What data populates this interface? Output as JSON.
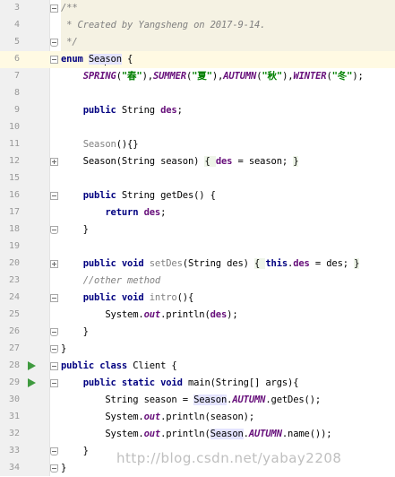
{
  "editor": {
    "current_line": "6",
    "lines": [
      {
        "n": "3",
        "tokens": [
          {
            "t": "/**",
            "c": "doc"
          }
        ],
        "fold": "open"
      },
      {
        "n": "4",
        "tokens": [
          {
            "t": " * Created by Yangsheng on 2017-9-14.",
            "c": "doc"
          }
        ]
      },
      {
        "n": "5",
        "tokens": [
          {
            "t": " */",
            "c": "doc"
          }
        ],
        "fold": "end"
      },
      {
        "n": "6",
        "tokens": [
          {
            "t": "enum ",
            "c": "kw"
          },
          {
            "t": "Sea",
            "c": "hl"
          },
          {
            "t": "son",
            "c": "hl"
          },
          {
            "t": " {",
            "c": ""
          }
        ],
        "fold": "open"
      },
      {
        "n": "7",
        "tokens": [
          {
            "t": "    ",
            "c": ""
          },
          {
            "t": "SPRING",
            "c": "const"
          },
          {
            "t": "(",
            "c": ""
          },
          {
            "t": "\"春\"",
            "c": "str"
          },
          {
            "t": "),",
            "c": ""
          },
          {
            "t": "SUMMER",
            "c": "const"
          },
          {
            "t": "(",
            "c": ""
          },
          {
            "t": "\"夏\"",
            "c": "str"
          },
          {
            "t": "),",
            "c": ""
          },
          {
            "t": "AUTUMN",
            "c": "const"
          },
          {
            "t": "(",
            "c": ""
          },
          {
            "t": "\"秋\"",
            "c": "str"
          },
          {
            "t": "),",
            "c": ""
          },
          {
            "t": "WINTER",
            "c": "const"
          },
          {
            "t": "(",
            "c": ""
          },
          {
            "t": "\"冬\"",
            "c": "str"
          },
          {
            "t": ");",
            "c": ""
          }
        ]
      },
      {
        "n": "8",
        "tokens": []
      },
      {
        "n": "9",
        "tokens": [
          {
            "t": "    ",
            "c": ""
          },
          {
            "t": "public ",
            "c": "kw"
          },
          {
            "t": "String ",
            "c": ""
          },
          {
            "t": "des",
            "c": "field"
          },
          {
            "t": ";",
            "c": ""
          }
        ]
      },
      {
        "n": "10",
        "tokens": []
      },
      {
        "n": "11",
        "tokens": [
          {
            "t": "    ",
            "c": ""
          },
          {
            "t": "Season",
            "c": "unused"
          },
          {
            "t": "(){}",
            "c": ""
          }
        ]
      },
      {
        "n": "12",
        "tokens": [
          {
            "t": "    Season(String season) ",
            "c": ""
          },
          {
            "t": "{ ",
            "c": "brace"
          },
          {
            "t": "des",
            "c": "field"
          },
          {
            "t": " = season; ",
            "c": ""
          },
          {
            "t": "}",
            "c": "brace"
          }
        ],
        "fold": "plus"
      },
      {
        "n": "15",
        "tokens": []
      },
      {
        "n": "16",
        "tokens": [
          {
            "t": "    ",
            "c": ""
          },
          {
            "t": "public ",
            "c": "kw"
          },
          {
            "t": "String getDes() {",
            "c": ""
          }
        ],
        "fold": "open"
      },
      {
        "n": "17",
        "tokens": [
          {
            "t": "        ",
            "c": ""
          },
          {
            "t": "return ",
            "c": "kw"
          },
          {
            "t": "des",
            "c": "field"
          },
          {
            "t": ";",
            "c": ""
          }
        ]
      },
      {
        "n": "18",
        "tokens": [
          {
            "t": "    }",
            "c": ""
          }
        ],
        "fold": "end"
      },
      {
        "n": "19",
        "tokens": []
      },
      {
        "n": "20",
        "tokens": [
          {
            "t": "    ",
            "c": ""
          },
          {
            "t": "public void ",
            "c": "kw"
          },
          {
            "t": "setDes",
            "c": "unused"
          },
          {
            "t": "(String des) ",
            "c": ""
          },
          {
            "t": "{ ",
            "c": "brace"
          },
          {
            "t": "this",
            "c": "kw"
          },
          {
            "t": ".",
            "c": ""
          },
          {
            "t": "des",
            "c": "field"
          },
          {
            "t": " = des; ",
            "c": ""
          },
          {
            "t": "}",
            "c": "brace"
          }
        ],
        "fold": "plus"
      },
      {
        "n": "23",
        "tokens": [
          {
            "t": "    ",
            "c": ""
          },
          {
            "t": "//other method",
            "c": "com"
          }
        ]
      },
      {
        "n": "24",
        "tokens": [
          {
            "t": "    ",
            "c": ""
          },
          {
            "t": "public void ",
            "c": "kw"
          },
          {
            "t": "intro",
            "c": "unused"
          },
          {
            "t": "(){",
            "c": ""
          }
        ],
        "fold": "open"
      },
      {
        "n": "25",
        "tokens": [
          {
            "t": "        System.",
            "c": ""
          },
          {
            "t": "out",
            "c": "static"
          },
          {
            "t": ".println(",
            "c": ""
          },
          {
            "t": "des",
            "c": "field"
          },
          {
            "t": ");",
            "c": ""
          }
        ]
      },
      {
        "n": "26",
        "tokens": [
          {
            "t": "    }",
            "c": ""
          }
        ],
        "fold": "end"
      },
      {
        "n": "27",
        "tokens": [
          {
            "t": "}",
            "c": ""
          }
        ],
        "fold": "end"
      },
      {
        "n": "28",
        "tokens": [
          {
            "t": "public class ",
            "c": "kw"
          },
          {
            "t": "Client {",
            "c": ""
          }
        ],
        "run": true,
        "fold": "open"
      },
      {
        "n": "29",
        "tokens": [
          {
            "t": "    ",
            "c": ""
          },
          {
            "t": "public static void ",
            "c": "kw"
          },
          {
            "t": "main(String[] args){",
            "c": ""
          }
        ],
        "run": true,
        "fold": "open"
      },
      {
        "n": "30",
        "tokens": [
          {
            "t": "        String season = ",
            "c": ""
          },
          {
            "t": "Season",
            "c": "hl"
          },
          {
            "t": ".",
            "c": ""
          },
          {
            "t": "AUTUMN",
            "c": "const"
          },
          {
            "t": ".getDes();",
            "c": ""
          }
        ]
      },
      {
        "n": "31",
        "tokens": [
          {
            "t": "        System.",
            "c": ""
          },
          {
            "t": "out",
            "c": "static"
          },
          {
            "t": ".println(season);",
            "c": ""
          }
        ]
      },
      {
        "n": "32",
        "tokens": [
          {
            "t": "        System.",
            "c": ""
          },
          {
            "t": "out",
            "c": "static"
          },
          {
            "t": ".println(",
            "c": ""
          },
          {
            "t": "Season",
            "c": "hl"
          },
          {
            "t": ".",
            "c": ""
          },
          {
            "t": "AUTUMN",
            "c": "const"
          },
          {
            "t": ".name());",
            "c": ""
          }
        ]
      },
      {
        "n": "33",
        "tokens": [
          {
            "t": "    }",
            "c": ""
          }
        ],
        "fold": "end"
      },
      {
        "n": "34",
        "tokens": [
          {
            "t": "}",
            "c": ""
          }
        ],
        "fold": "end"
      }
    ]
  },
  "watermark": "http://blog.csdn.net/yabay2208"
}
